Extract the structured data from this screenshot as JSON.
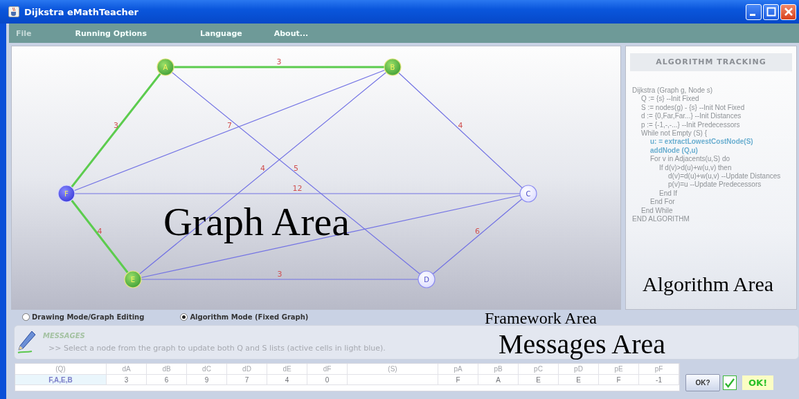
{
  "window": {
    "title": "Dijkstra eMathTeacher"
  },
  "menu": [
    {
      "label": "File",
      "disabled": true
    },
    {
      "label": "Running Options",
      "disabled": false
    },
    {
      "label": "Language",
      "disabled": false
    },
    {
      "label": "About...",
      "disabled": false
    }
  ],
  "graph": {
    "nodes": [
      {
        "label": "A",
        "fixed": true,
        "current": false
      },
      {
        "label": "B",
        "fixed": true,
        "current": false
      },
      {
        "label": "C",
        "fixed": false,
        "current": false
      },
      {
        "label": "D",
        "fixed": false,
        "current": false
      },
      {
        "label": "E",
        "fixed": true,
        "current": false
      },
      {
        "label": "F",
        "fixed": false,
        "current": true
      }
    ],
    "edges": [
      {
        "weight": "3",
        "in_tree": true
      },
      {
        "weight": "3",
        "in_tree": true
      },
      {
        "weight": "4",
        "in_tree": true
      },
      {
        "weight": "7",
        "in_tree": false
      },
      {
        "weight": "5",
        "in_tree": false
      },
      {
        "weight": "12",
        "in_tree": false
      },
      {
        "weight": "4",
        "in_tree": false
      },
      {
        "in_tree": false
      },
      {
        "weight": "3",
        "in_tree": false
      },
      {
        "weight": "4",
        "in_tree": false
      },
      {
        "weight": "6",
        "in_tree": false
      }
    ]
  },
  "algorithm": {
    "title": "ALGORITHM TRACKING",
    "lines": [
      {
        "text": "Dijkstra (Graph g, Node s)",
        "highlighted": false,
        "children": [
          {
            "text": "Q := {s} --Init Fixed",
            "highlighted": false
          },
          {
            "text": "S := nodes(g) - {s} --Init Not Fixed",
            "highlighted": false
          },
          {
            "text": "d := {0,Far,Far...} --Init Distances",
            "highlighted": false
          },
          {
            "text": "p := {-1,-,-...}  --Init Predecessors",
            "highlighted": false
          },
          {
            "text": "While not Empty (S) {",
            "highlighted": false,
            "children": [
              {
                "text": "u: = extractLowestCostNode(S)",
                "highlighted": true
              },
              {
                "text": "addNode (Q,u)",
                "highlighted": true
              },
              {
                "text": "For v in Adjacents(u,S) do",
                "highlighted": false,
                "children": [
                  {
                    "text": "If  d(v)>d(u)+w(u,v) then",
                    "highlighted": false,
                    "children": [
                      {
                        "text": "d(v)=d(u)+w(u,v)  --Update Distances",
                        "highlighted": false
                      },
                      {
                        "text": "p(v)=u  --Update Predecessors",
                        "highlighted": false
                      }
                    ]
                  },
                  {
                    "text": "End If",
                    "highlighted": false
                  }
                ]
              },
              {
                "text": "End For",
                "highlighted": false
              }
            ]
          },
          {
            "text": "End While",
            "highlighted": false
          }
        ]
      },
      {
        "text": "END ALGORITHM",
        "highlighted": false
      }
    ]
  },
  "modes": [
    {
      "label": "Drawing Mode/Graph Editing",
      "selected": false
    },
    {
      "label": "Algorithm Mode (Fixed Graph)",
      "selected": true
    }
  ],
  "messages": {
    "title": "MESSAGES",
    "text": ">> Select a node from the graph to update both Q and S lists (active cells in light blue)."
  },
  "framework": {
    "columns": [
      "(Q)",
      "dA",
      "dB",
      "dC",
      "dD",
      "dE",
      "dF",
      "(S)",
      "pA",
      "pB",
      "pC",
      "pD",
      "pE",
      "pF"
    ],
    "rows": [
      [
        "F,A,E,B",
        "3",
        "6",
        "9",
        "7",
        "4",
        "0",
        null,
        "F",
        "A",
        "E",
        "E",
        "F",
        "-1"
      ]
    ]
  },
  "check_button": "OK?",
  "verified": true,
  "result": "OK!",
  "annotations": [
    "Graph Area",
    "Algorithm Area",
    "Messages Area",
    "Framework Area"
  ]
}
